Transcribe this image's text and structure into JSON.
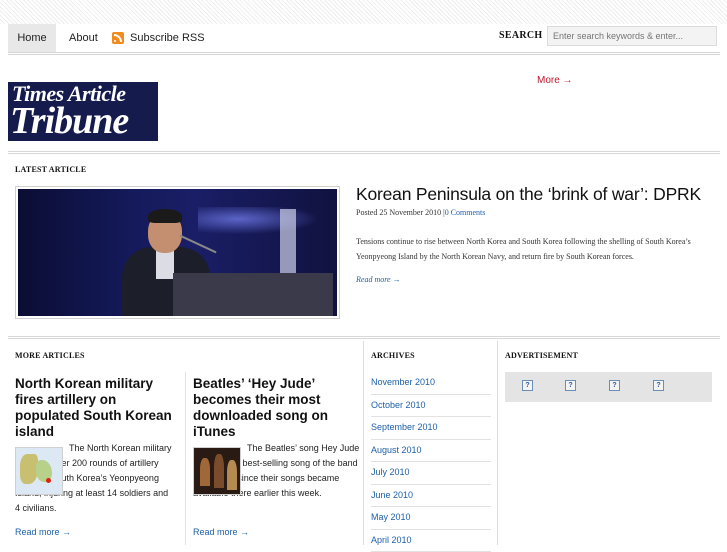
{
  "nav": {
    "items": [
      {
        "label": "Home"
      },
      {
        "label": "About"
      },
      {
        "label": "Subscribe RSS"
      }
    ],
    "search_label": "SEARCH",
    "search_placeholder": "Enter search keywords & enter..."
  },
  "logo": {
    "line1": "Times Article",
    "line2": "Tribune"
  },
  "more_link": "More →",
  "latest": {
    "heading": "LATEST ARTICLE",
    "title": "Korean Peninsula on the ‘brink of war’: DPRK",
    "posted": "Posted 25 November 2010 |",
    "comments": "0 Comments",
    "excerpt": "Tensions continue to rise between North Korea and South Korea following the shelling of South Korea’s Yeonpyeong Island by the North Korean Navy, and return fire by South Korean forces.",
    "read_more": "Read more →"
  },
  "more_articles": {
    "heading": "MORE ARTICLES",
    "items": [
      {
        "title": "North Korean military fires artillery on populated South Korean island",
        "text": "The North Korean military has fired over 200 rounds of artillery shells at South Korea’s Yeonpyeong Island, injuring at least 14 soldiers and 4 civilians.",
        "read_more": "Read more →"
      },
      {
        "title": "Beatles’ ‘Hey Jude’ becomes their most downloaded song on iTunes",
        "text": "The Beatles’ song Hey Jude became the best-selling song of the band on iTunes, since their songs became available there earlier this week.",
        "read_more": "Read more →"
      }
    ]
  },
  "archives": {
    "heading": "ARCHIVES",
    "items": [
      "November 2010",
      "October 2010",
      "September 2010",
      "August 2010",
      "July 2010",
      "June 2010",
      "May 2010",
      "April 2010"
    ]
  },
  "advertisement": {
    "heading": "ADVERTISEMENT",
    "slots": [
      "?",
      "?",
      "?",
      "?"
    ]
  },
  "colors": {
    "link": "#1d5fa8",
    "accent_red": "#c0162b",
    "logo_bg": "#151b4d",
    "rss": "#f28a1e"
  }
}
